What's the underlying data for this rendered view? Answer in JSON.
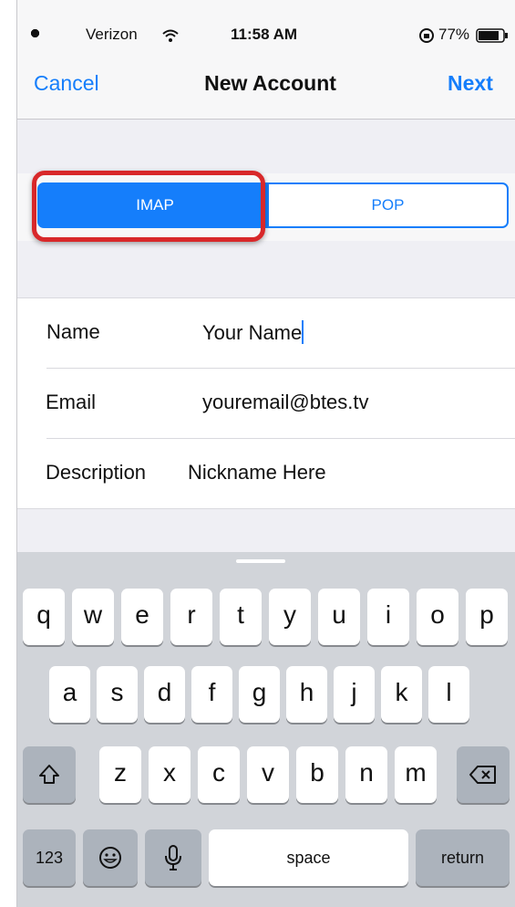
{
  "status_bar": {
    "carrier": "Verizon",
    "time": "11:58 AM",
    "battery": "77%"
  },
  "nav": {
    "cancel": "Cancel",
    "title": "New Account",
    "next": "Next"
  },
  "segment": {
    "imap": "IMAP",
    "pop": "POP",
    "selected": "IMAP"
  },
  "form": {
    "name_label": "Name",
    "name_value": "Your Name",
    "email_label": "Email",
    "email_value": "youremail@btes.tv",
    "description_label": "Description",
    "description_value": "Nickname Here"
  },
  "keyboard": {
    "row1": [
      "q",
      "w",
      "e",
      "r",
      "t",
      "y",
      "u",
      "i",
      "o",
      "p"
    ],
    "row2": [
      "a",
      "s",
      "d",
      "f",
      "g",
      "h",
      "j",
      "k",
      "l"
    ],
    "row3": [
      "z",
      "x",
      "c",
      "v",
      "b",
      "n",
      "m"
    ],
    "numbers": "123",
    "space": "space",
    "return": "return"
  },
  "colors": {
    "accent": "#157efb",
    "highlight": "#d8282a"
  }
}
